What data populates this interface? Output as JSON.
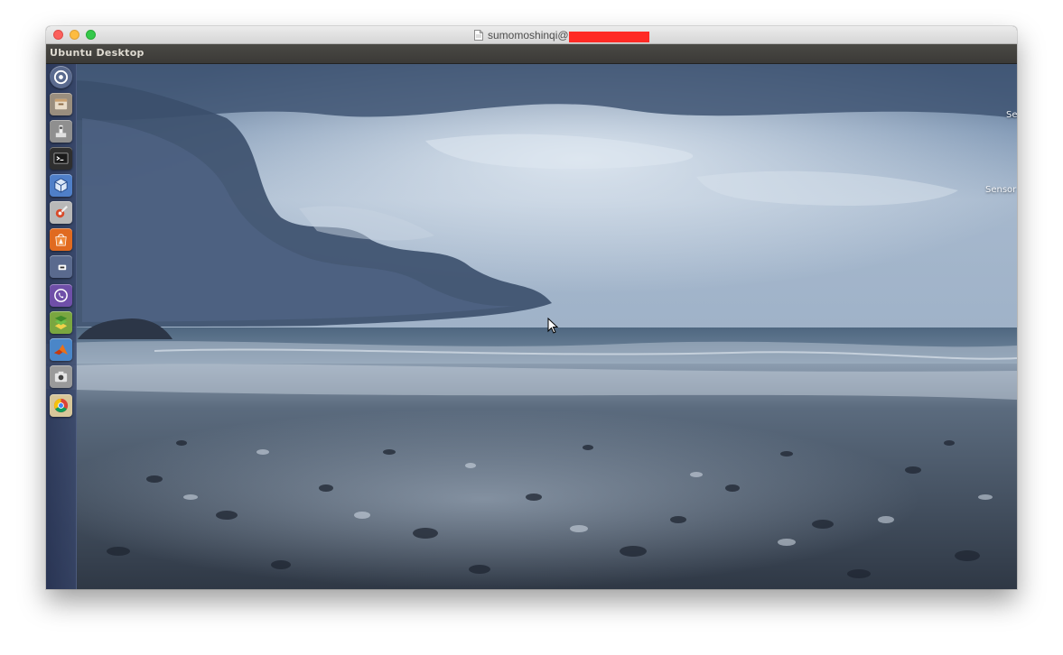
{
  "mac_window": {
    "title": "sumomoshinqi@"
  },
  "vm_window": {
    "title": "Ubuntu Desktop"
  },
  "desktop": {
    "widgets": [
      "Se",
      "Sensor"
    ]
  },
  "launcher": {
    "items": [
      {
        "icon": "dash-home-icon",
        "bg": "#5a6a8e"
      },
      {
        "icon": "files-icon",
        "bg": "#9a8e7e"
      },
      {
        "icon": "system-tool-icon",
        "bg": "#8f8f8f"
      },
      {
        "icon": "terminal-icon",
        "bg": "#2f2f2f"
      },
      {
        "icon": "virtualbox-icon",
        "bg": "#4f7fc8"
      },
      {
        "icon": "system-settings-icon",
        "bg": "#b8b8b8"
      },
      {
        "icon": "software-center-icon",
        "bg": "#e06a20"
      },
      {
        "icon": "drive-icon",
        "bg": "#5a6a8e"
      },
      {
        "icon": "viber-icon",
        "bg": "#6f4fa8"
      },
      {
        "icon": "maps-icon",
        "bg": "#7aa640"
      },
      {
        "icon": "matlab-icon",
        "bg": "#4a86c8"
      },
      {
        "icon": "camera-icon",
        "bg": "#9a9a9a"
      },
      {
        "icon": "chrome-icon",
        "bg": "#d8c79a"
      }
    ]
  }
}
